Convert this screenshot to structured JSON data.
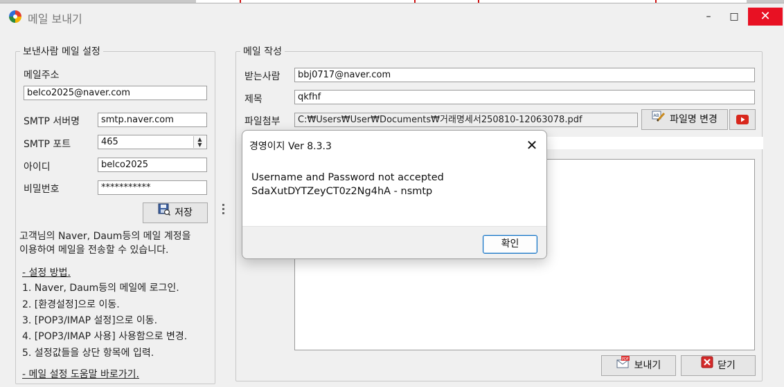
{
  "window": {
    "title": "메일 보내기",
    "minimize_glyph": "–",
    "maximize_glyph": "□",
    "close_glyph": "✕"
  },
  "sender": {
    "legend": "보낸사람 메일 설정",
    "email_label": "메일주소",
    "email_value": "belco2025@naver.com",
    "smtp_server_label": "SMTP 서버명",
    "smtp_server_value": "smtp.naver.com",
    "smtp_port_label": "SMTP 포트",
    "smtp_port_value": "465",
    "id_label": "아이디",
    "id_value": "belco2025",
    "password_label": "비밀번호",
    "password_value": "***********",
    "save_label": "저장",
    "info": [
      "고객님의 Naver, Daum등의 메일 계정을",
      "이용하여 메일을 전송할 수 있습니다.",
      "- 설정 방법.",
      "1. Naver, Daum등의 메일에 로그인.",
      "2. [환경설정]으로 이동.",
      "3. [POP3/IMAP 설정]으로 이동.",
      "4. [POP3/IMAP 사용] 사용함으로 변경.",
      "5. 설정값들을 상단 항목에 입력.",
      "- 메일 설정 도움말 바로가기."
    ]
  },
  "compose": {
    "legend": "메일 작성",
    "to_label": "받는사람",
    "to_value": "bbj0717@naver.com",
    "subject_label": "제목",
    "subject_value": "qkfhf",
    "attach_label": "파일첨부",
    "attach_value": "C:₩Users₩User₩Documents₩거래명세서250810-12063078.pdf",
    "rename_label": "파일명 변경",
    "send_label": "보내기",
    "close_label": "닫기"
  },
  "dialog": {
    "title": "경영이지 Ver 8.3.3",
    "message_line1": "Username and Password not accepted",
    "message_line2": "SdaXutDYTZeyCT0z2Ng4hA - nsmtp",
    "ok_label": "확인",
    "close_glyph": "✕"
  },
  "icons": {
    "app": "app-logo-icon",
    "save": "save-disk-icon",
    "rename": "rename-icon",
    "preview": "play-icon",
    "send": "pdf-mail-icon",
    "close": "close-red-icon"
  },
  "colors": {
    "window_close": "#e81123",
    "dialog_ok_border": "#0067c0",
    "play_red": "#d8271c"
  }
}
